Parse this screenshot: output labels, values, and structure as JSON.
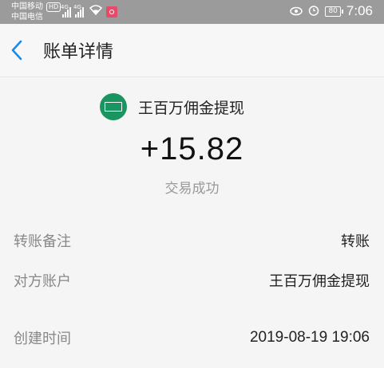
{
  "status_bar": {
    "carrier1": "中国移动",
    "hd_badge": "HD",
    "carrier2": "中国电信",
    "signal1_label": "4G",
    "signal2_label": "4G",
    "battery": "80",
    "time": "7:06"
  },
  "header": {
    "title": "账单详情"
  },
  "summary": {
    "merchant_name": "王百万佣金提现",
    "amount": "+15.82",
    "status": "交易成功"
  },
  "details": [
    {
      "label": "转账备注",
      "value": "转账"
    },
    {
      "label": "对方账户",
      "value": "王百万佣金提现"
    },
    {
      "label": "创建时间",
      "value": "2019-08-19 19:06"
    }
  ],
  "colors": {
    "accent": "#1a8ce8",
    "logo": "#1a9460",
    "status_bar": "#9b9b9b"
  }
}
